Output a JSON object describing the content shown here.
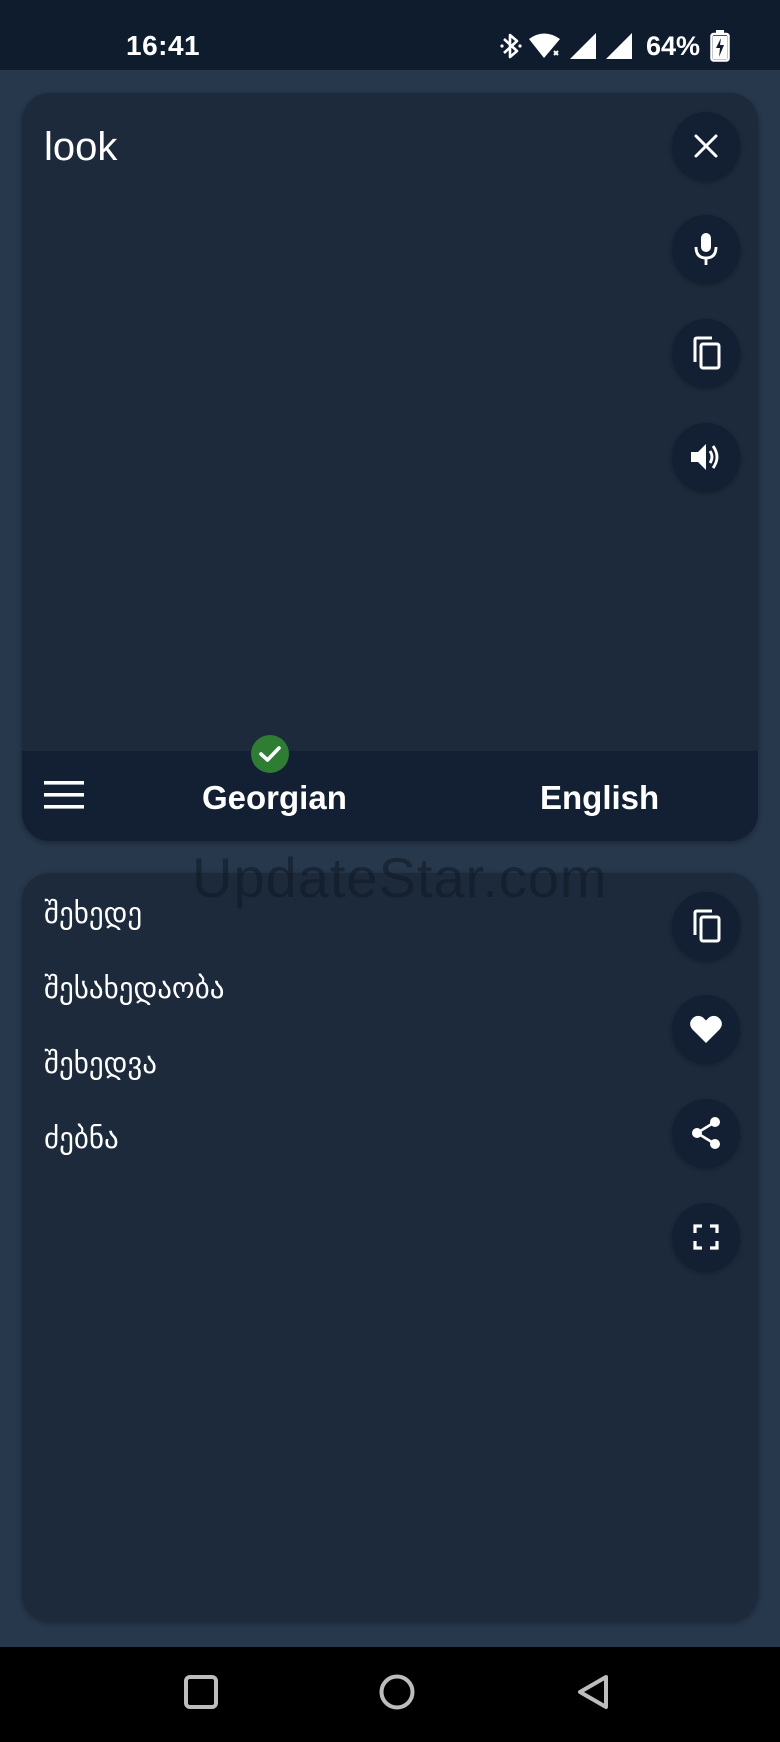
{
  "status_bar": {
    "time": "16:41",
    "battery_percent": "64%",
    "icons": [
      "bluetooth-icon",
      "wifi-icon",
      "signal-icon",
      "signal-icon",
      "battery-charging-icon"
    ]
  },
  "input": {
    "source_text": "look",
    "actions": [
      "close-icon",
      "microphone-icon",
      "copy-icon",
      "speaker-icon"
    ]
  },
  "language_bar": {
    "menu_icon": "menu-icon",
    "source_language": "Georgian",
    "target_language": "English",
    "selected_indicator": "check-circle-icon"
  },
  "output": {
    "translations": [
      "შეხედე",
      "შესახედაობა",
      "შეხედვა",
      "ძებნა"
    ],
    "actions": [
      "copy-icon",
      "heart-icon",
      "share-icon",
      "fullscreen-icon"
    ]
  },
  "watermark": "UpdateStar.com",
  "nav_bar": {
    "buttons": [
      "recents-square-icon",
      "home-circle-icon",
      "back-triangle-icon"
    ]
  },
  "colors": {
    "background": "#27384d",
    "card": "#1d2a3c",
    "bar": "#132034",
    "status_bar": "#0f1c2e",
    "check": "#2e7d32"
  }
}
